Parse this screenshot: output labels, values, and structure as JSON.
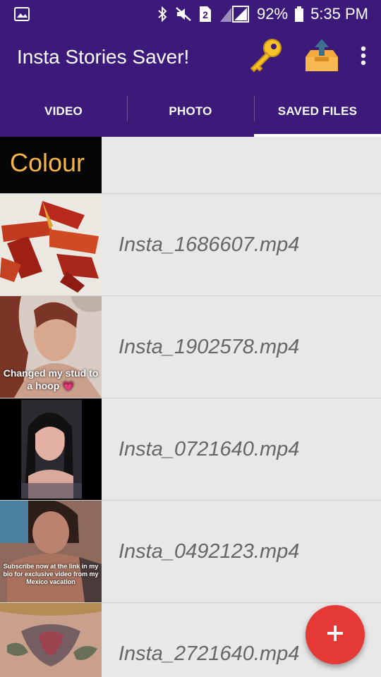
{
  "status_bar": {
    "battery_percent": "92%",
    "time": "5:35 PM",
    "sim_slot": "2",
    "icons": [
      "image-notification-icon",
      "bluetooth-icon",
      "mute-icon",
      "sim-icon",
      "signal-icon",
      "battery-icon"
    ]
  },
  "app": {
    "title": "Insta Stories Saver!",
    "key_icon": "key-icon",
    "upload_icon": "upload-box-icon",
    "menu_icon": "more-vert-icon"
  },
  "tabs": [
    {
      "label": "VIDEO",
      "active": false
    },
    {
      "label": "PHOTO",
      "active": false
    },
    {
      "label": "SAVED FILES",
      "active": true
    }
  ],
  "files": [
    {
      "name": "",
      "thumb_text": "Colour"
    },
    {
      "name": "Insta_1686607.mp4",
      "thumb_text": ""
    },
    {
      "name": "Insta_1902578.mp4",
      "thumb_text": "Changed my stud to a hoop 💗"
    },
    {
      "name": "Insta_0721640.mp4",
      "thumb_text": ""
    },
    {
      "name": "Insta_0492123.mp4",
      "thumb_text": "Subscribe now at the link in my bio for exclusive video from my Mexico vacation"
    },
    {
      "name": "Insta_2721640.mp4",
      "thumb_text": ""
    }
  ],
  "fab": {
    "label": "+",
    "icon": "plus-icon"
  },
  "colors": {
    "app_bar": "#3b1a7a",
    "accent": "#e53935",
    "list_bg": "#e8e8e8",
    "file_text": "#666666"
  }
}
